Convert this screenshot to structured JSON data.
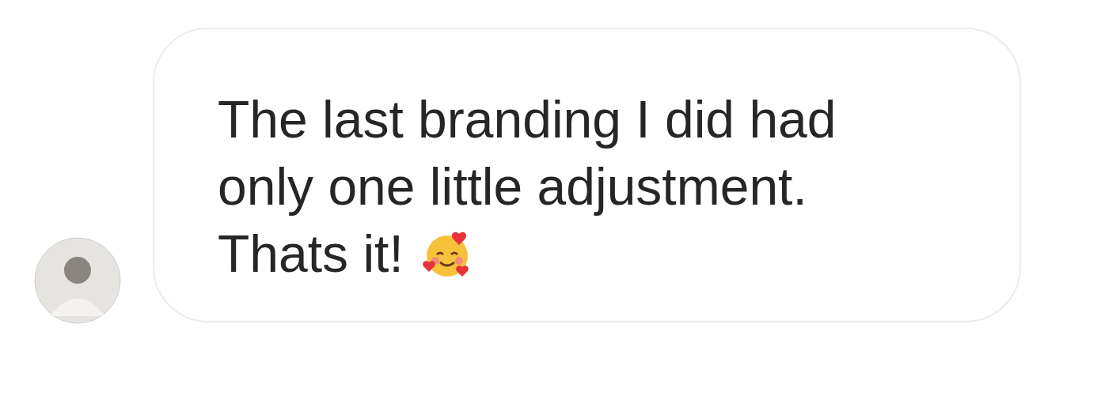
{
  "message": {
    "text": "The last branding I did had only one little adjustment. Thats it!"
  }
}
